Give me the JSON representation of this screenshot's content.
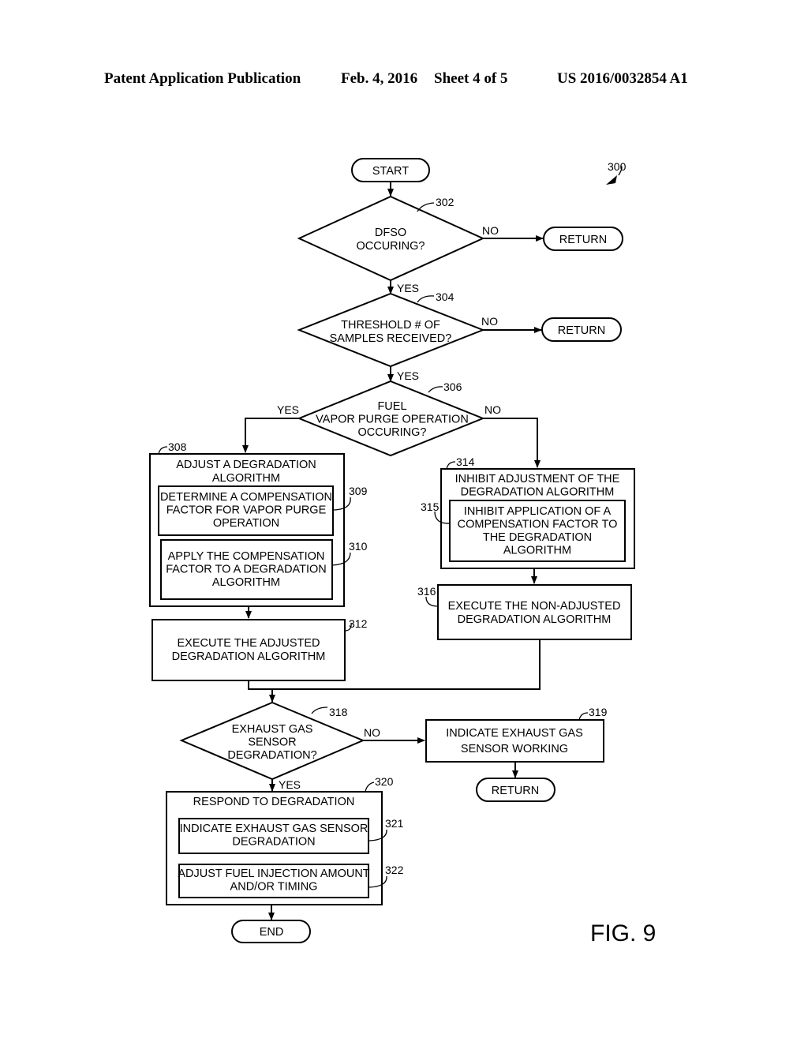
{
  "header": {
    "publication": "Patent Application Publication",
    "date": "Feb. 4, 2016",
    "sheet": "Sheet 4 of 5",
    "number": "US 2016/0032854 A1"
  },
  "figure": {
    "label": "FIG. 9",
    "ref": "300"
  },
  "flowchart": {
    "start": "START",
    "end": "END",
    "edge_labels": {
      "yes": "YES",
      "no": "NO"
    },
    "nodes": {
      "n302": {
        "ref": "302",
        "lines": [
          "DFSO",
          "OCCURING?"
        ]
      },
      "r302": {
        "lines": [
          "RETURN"
        ]
      },
      "n304": {
        "ref": "304",
        "lines": [
          "THRESHOLD # OF",
          "SAMPLES RECEIVED?"
        ]
      },
      "r304": {
        "lines": [
          "RETURN"
        ]
      },
      "n306": {
        "ref": "306",
        "lines": [
          "FUEL",
          "VAPOR PURGE OPERATION",
          "OCCURING?"
        ]
      },
      "n308": {
        "ref": "308",
        "lines": [
          "ADJUST A DEGRADATION",
          "ALGORITHM"
        ]
      },
      "n309": {
        "ref": "309",
        "lines": [
          "DETERMINE A COMPENSATION",
          "FACTOR FOR VAPOR PURGE",
          "OPERATION"
        ]
      },
      "n310": {
        "ref": "310",
        "lines": [
          "APPLY THE COMPENSATION",
          "FACTOR TO A DEGRADATION",
          "ALGORITHM"
        ]
      },
      "n312": {
        "ref": "312",
        "lines": [
          "EXECUTE THE ADJUSTED",
          "DEGRADATION ALGORITHM"
        ]
      },
      "n314": {
        "ref": "314",
        "lines": [
          "INHIBIT ADJUSTMENT OF THE",
          "DEGRADATION ALGORITHM"
        ]
      },
      "n315": {
        "ref": "315",
        "lines": [
          "INHIBIT APPLICATION OF A",
          "COMPENSATION FACTOR TO",
          "THE DEGRADATION",
          "ALGORITHM"
        ]
      },
      "n316": {
        "ref": "316",
        "lines": [
          "EXECUTE THE NON-ADJUSTED",
          "DEGRADATION ALGORITHM"
        ]
      },
      "n318": {
        "ref": "318",
        "lines": [
          "EXHAUST GAS",
          "SENSOR",
          "DEGRADATION?"
        ]
      },
      "n319": {
        "ref": "319",
        "lines": [
          "INDICATE EXHAUST GAS",
          "SENSOR WORKING"
        ]
      },
      "r319": {
        "lines": [
          "RETURN"
        ]
      },
      "n320": {
        "ref": "320",
        "lines": [
          "RESPOND TO DEGRADATION"
        ]
      },
      "n321": {
        "ref": "321",
        "lines": [
          "INDICATE EXHAUST GAS SENSOR",
          "DEGRADATION"
        ]
      },
      "n322": {
        "ref": "322",
        "lines": [
          "ADJUST FUEL INJECTION AMOUNT",
          "AND/OR TIMING"
        ]
      }
    }
  }
}
